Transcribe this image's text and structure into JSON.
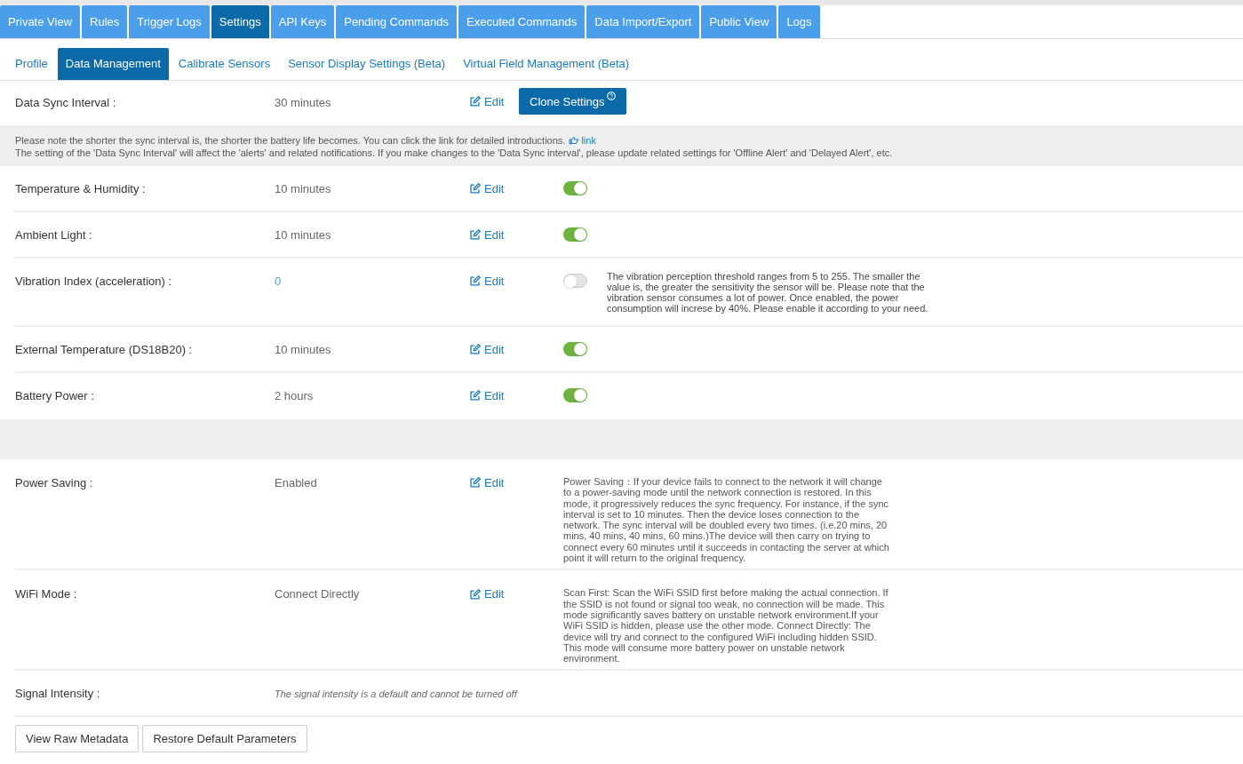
{
  "main_tabs": [
    {
      "label": "Private View",
      "selected": false
    },
    {
      "label": "Rules",
      "selected": false
    },
    {
      "label": "Trigger Logs",
      "selected": false
    },
    {
      "label": "Settings",
      "selected": true
    },
    {
      "label": "API Keys",
      "selected": false
    },
    {
      "label": "Pending Commands",
      "selected": false
    },
    {
      "label": "Executed Commands",
      "selected": false
    },
    {
      "label": "Data Import/Export",
      "selected": false
    },
    {
      "label": "Public View",
      "selected": false
    },
    {
      "label": "Logs",
      "selected": false
    }
  ],
  "sub_tabs": [
    {
      "label": "Profile",
      "selected": false
    },
    {
      "label": "Data Management",
      "selected": true
    },
    {
      "label": "Calibrate Sensors",
      "selected": false
    },
    {
      "label": "Sensor Display Settings (Beta)",
      "selected": false
    },
    {
      "label": "Virtual Field Management (Beta)",
      "selected": false
    }
  ],
  "sync": {
    "label": "Data Sync Interval :",
    "value": "30 minutes",
    "edit": "Edit",
    "clone_button": "Clone Settings"
  },
  "notice": [
    {
      "text": "Please note the shorter the sync interval is, the shorter the battery life becomes. You can click the link for detailed introductions.",
      "link": "link"
    },
    {
      "text": "The setting of the 'Data Sync Interval' will affect the 'alerts' and related notifications. If you make changes to the 'Data Sync interval', please update related settings for 'Offline Alert' and 'Delayed Alert', etc."
    }
  ],
  "sensors": [
    {
      "label": "Temperature & Humidity :",
      "value": "10 minutes",
      "kind": "interval",
      "edit": "Edit",
      "on": true
    },
    {
      "label": "Ambient Light :",
      "value": "10 minutes",
      "kind": "interval",
      "edit": "Edit",
      "on": true
    },
    {
      "label": "Vibration Index (acceleration) :",
      "value": "0",
      "kind": "threshold",
      "edit": "Edit",
      "on": false,
      "note": "The vibration perception threshold ranges from 5 to 255. The smaller the value is, the greater the sensitivity the sensor will be. Please note that the vibration sensor consumes a lot of power. Once enabled, the power consumption will increse by 40%. Please enable it according to your need."
    },
    {
      "label": "External Temperature (DS18B20) :",
      "value": "10 minutes",
      "kind": "interval",
      "edit": "Edit",
      "on": true
    },
    {
      "label": "Battery Power :",
      "value": "2 hours",
      "kind": "interval",
      "edit": "Edit",
      "on": true
    }
  ],
  "settings": [
    {
      "label": "Power Saving :",
      "value": "Enabled",
      "edit": "Edit",
      "note": "Power Saving：If your device fails to connect to the network it will change to a power-saving mode until the network connection is restored. In this mode, it progressively reduces the sync frequency. For instance, if the sync interval is set to 10 minutes. Then the device loses connection to the network. The sync interval will be doubled every two times. (i.e.20 mins, 20 mins, 40 mins, 40 mins, 60 mins.)The device will then carry on trying to connect every 60 minutes until it succeeds in contacting the server at which point it will return to the original frequency."
    },
    {
      "label": "WiFi Mode :",
      "value": "Connect Directly",
      "edit": "Edit",
      "note": "Scan First: Scan the WiFi SSID first before making the actual connection. If the SSID is not found or signal too weak, no connection will be made. This mode significantly saves battery on unstable network environment.If your WiFi SSID is hidden, please use the other mode. Connect Directly: The device will try and connect to the configured WiFi including hidden SSID. This mode will consume more battery power on unstable network environment."
    }
  ],
  "signal": {
    "label": "Signal Intensity :",
    "note": "The signal intensity is a default and cannot be turned off"
  },
  "buttons": [
    "View Raw Metadata",
    "Restore Default Parameters"
  ]
}
